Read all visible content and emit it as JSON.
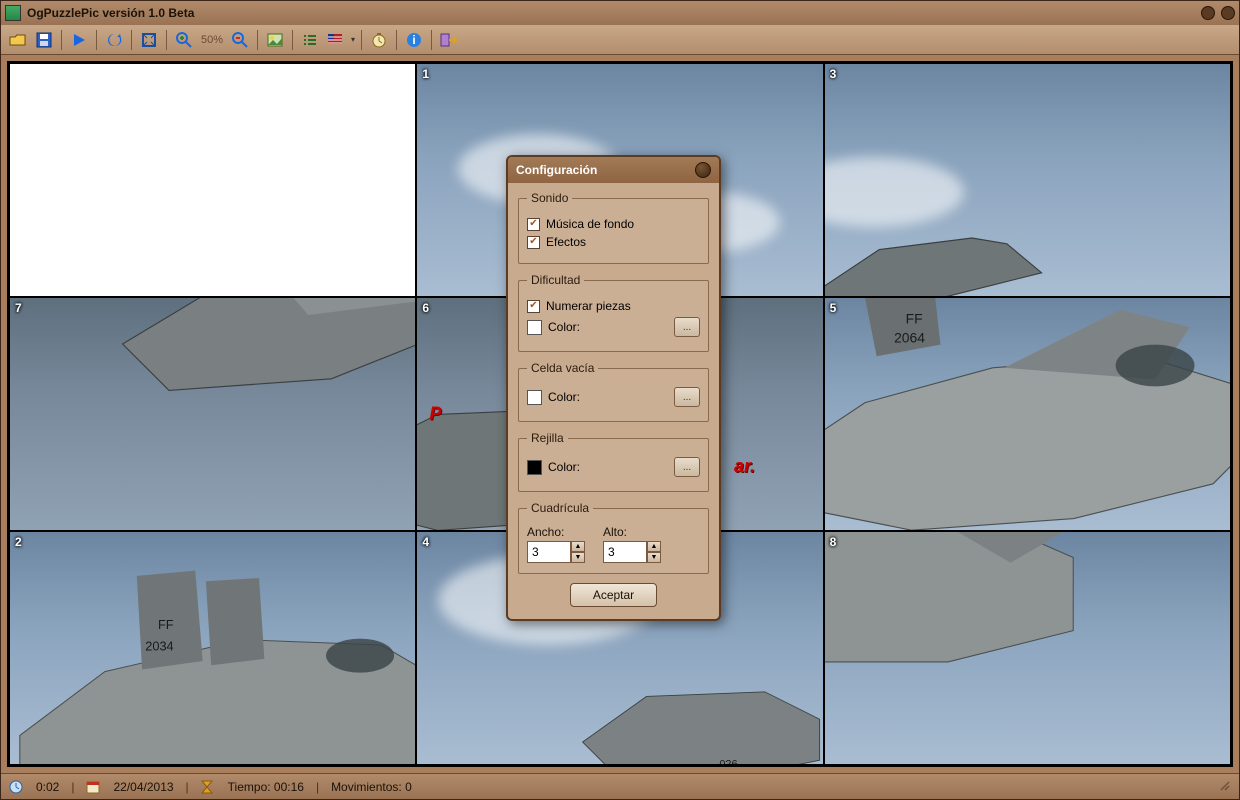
{
  "app": {
    "title": "OgPuzzlePic versión 1.0 Beta"
  },
  "toolbar": {
    "zoom_level": "50%"
  },
  "puzzle": {
    "grid_cells": [
      "",
      "1",
      "3",
      "7",
      "6",
      "5",
      "2",
      "4",
      "8"
    ],
    "overlay_text_left": "P",
    "overlay_text_right": "ar."
  },
  "dialog": {
    "title": "Configuración",
    "groups": {
      "sonido": {
        "legend": "Sonido",
        "musica": "Música de fondo",
        "efectos": "Efectos"
      },
      "dificultad": {
        "legend": "Dificultad",
        "numerar": "Numerar piezas",
        "color": "Color:"
      },
      "celda_vacia": {
        "legend": "Celda vacía",
        "color": "Color:"
      },
      "rejilla": {
        "legend": "Rejilla",
        "color": "Color:"
      },
      "cuadricula": {
        "legend": "Cuadrícula",
        "ancho_label": "Ancho:",
        "alto_label": "Alto:",
        "ancho": "3",
        "alto": "3"
      }
    },
    "accept": "Aceptar",
    "picker": "..."
  },
  "statusbar": {
    "clock": "0:02",
    "date": "22/04/2013",
    "tiempo": "Tiempo: 00:16",
    "movimientos": "Movimientos: 0"
  }
}
